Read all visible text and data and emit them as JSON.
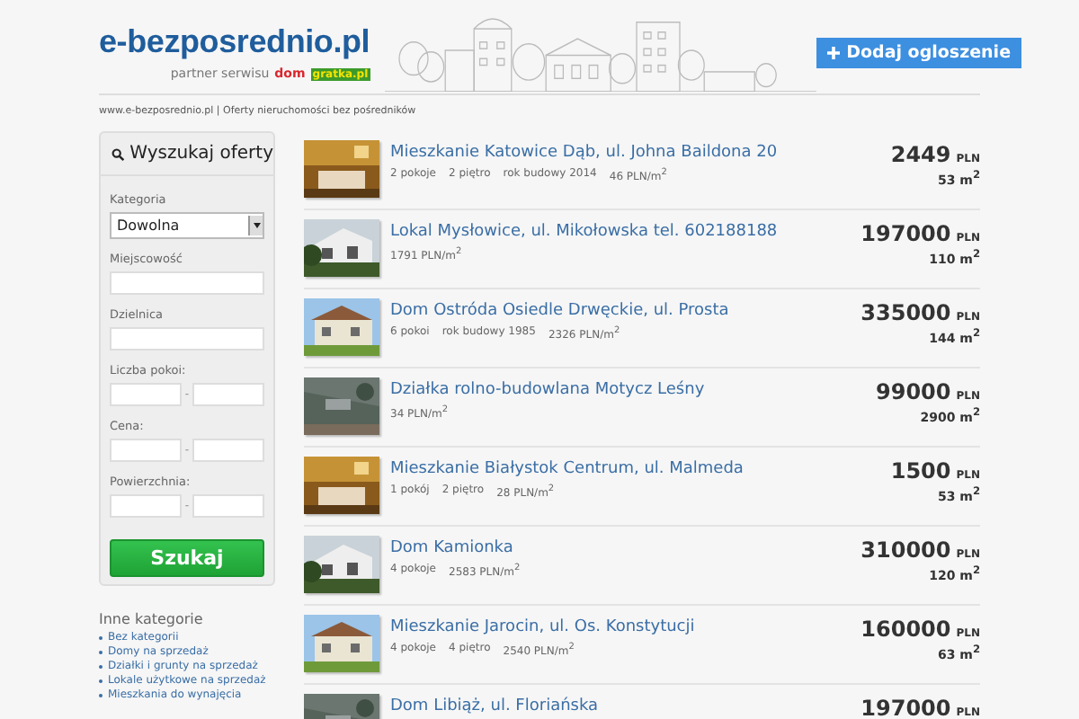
{
  "header": {
    "logo": "e-bezposrednio.pl",
    "partner_label": "partner serwisu",
    "partner_logo_part1": "dom",
    "partner_logo_part2": "gratka.pl",
    "add_button": "Dodaj ogloszenie"
  },
  "breadcrumb": "www.e-bezposrednio.pl | Oferty nieruchomości bez pośredników",
  "search": {
    "title": "Wyszukaj oferty",
    "fields": [
      {
        "kind": "select",
        "label": "Kategoria",
        "value": "Dowolna"
      },
      {
        "kind": "text",
        "label": "Miejscowość"
      },
      {
        "kind": "text",
        "label": "Dzielnica"
      },
      {
        "kind": "range",
        "label": "Liczba pokoi:",
        "separator": "-"
      },
      {
        "kind": "range",
        "label": "Cena:",
        "separator": "-"
      },
      {
        "kind": "range",
        "label": "Powierzchnia:",
        "separator": "-"
      }
    ],
    "submit": "Szukaj"
  },
  "other_categories": {
    "title": "Inne kategorie",
    "items": [
      "Bez kategorii",
      "Domy na sprzedaż",
      "Działki i grunty na sprzedaż",
      "Lokale użytkowe na sprzedaż",
      "Mieszkania do wynajęcia"
    ]
  },
  "listings": [
    {
      "title": "Mieszkanie Katowice Dąb, ul. Johna Baildona 20",
      "details": [
        "2 pokoje",
        "2 piętro",
        "rok budowy 2014",
        "46 PLN/m$^{2}$"
      ],
      "price": "2449",
      "currency": "PLN",
      "area": "53 m$^{2}$"
    },
    {
      "title": "Lokal Mysłowice, ul. Mikołowska tel. 602188188",
      "details": [
        "1791 PLN/m$^{2}$"
      ],
      "price": "197000",
      "currency": "PLN",
      "area": "110 m$^{2}$"
    },
    {
      "title": "Dom Ostróda Osiedle Drwęckie, ul. Prosta",
      "details": [
        "6 pokoi",
        "rok budowy 1985",
        "2326 PLN/m$^{2}$"
      ],
      "price": "335000",
      "currency": "PLN",
      "area": "144 m$^{2}$"
    },
    {
      "title": "Działka rolno-budowlana Motycz Leśny",
      "details": [
        "34 PLN/m$^{2}$"
      ],
      "price": "99000",
      "currency": "PLN",
      "area": "2900 m$^{2}$"
    },
    {
      "title": "Mieszkanie Białystok Centrum, ul. Malmeda",
      "details": [
        "1 pokój",
        "2 piętro",
        "28 PLN/m$^{2}$"
      ],
      "price": "1500",
      "currency": "PLN",
      "area": "53 m$^{2}$"
    },
    {
      "title": "Dom Kamionka",
      "details": [
        "4 pokoje",
        "2583 PLN/m$^{2}$"
      ],
      "price": "310000",
      "currency": "PLN",
      "area": "120 m$^{2}$"
    },
    {
      "title": "Mieszkanie Jarocin, ul. Os. Konstytucji",
      "details": [
        "4 pokoje",
        "4 piętro",
        "2540 PLN/m$^{2}$"
      ],
      "price": "160000",
      "currency": "PLN",
      "area": "63 m$^{2}$"
    },
    {
      "title": "Dom Libiąż, ul. Floriańska",
      "price": "197000",
      "currency": "PLN"
    }
  ]
}
